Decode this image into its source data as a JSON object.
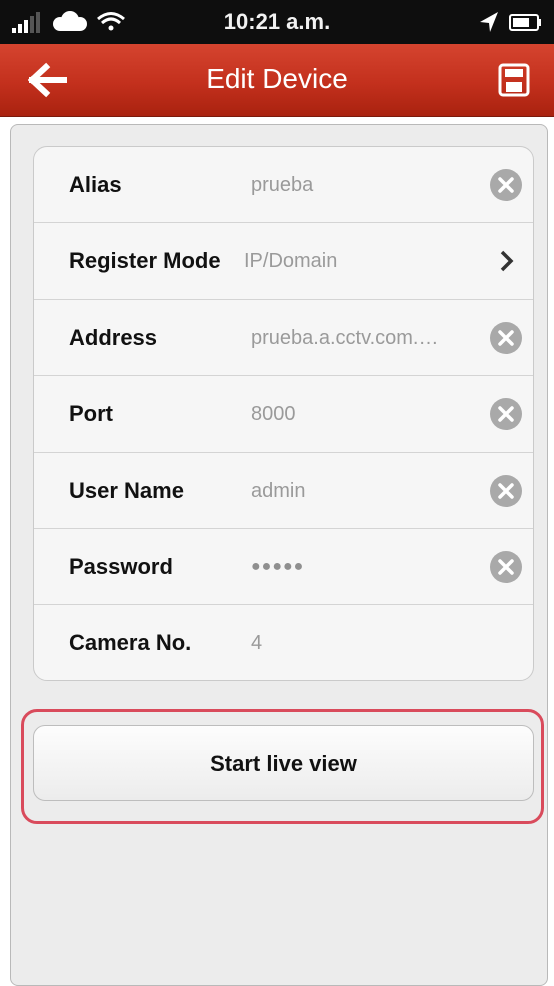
{
  "status_bar": {
    "time": "10:21 a.m.",
    "icons": [
      "signal-icon",
      "cloud-icon",
      "wifi-icon",
      "location-icon",
      "battery-icon"
    ]
  },
  "nav": {
    "title": "Edit Device",
    "back_icon": "back-arrow-icon",
    "save_icon": "save-icon"
  },
  "form": {
    "rows": [
      {
        "label": "Alias",
        "value": "prueba",
        "accessory": "clear-icon"
      },
      {
        "label": "Register Mode",
        "value": "IP/Domain",
        "accessory": "chevron-right-icon"
      },
      {
        "label": "Address",
        "value": "prueba.a.cctv.com.…",
        "accessory": "clear-icon"
      },
      {
        "label": "Port",
        "value": "8000",
        "accessory": "clear-icon"
      },
      {
        "label": "User Name",
        "value": "admin",
        "accessory": "clear-icon"
      },
      {
        "label": "Password",
        "value": "●●●●●",
        "accessory": "clear-icon"
      },
      {
        "label": "Camera No.",
        "value": "4",
        "accessory": ""
      }
    ]
  },
  "actions": {
    "start_live_view": "Start live view"
  },
  "colors": {
    "nav_red": "#c3301d",
    "highlight": "#d94b5c",
    "background": "#ececec"
  }
}
